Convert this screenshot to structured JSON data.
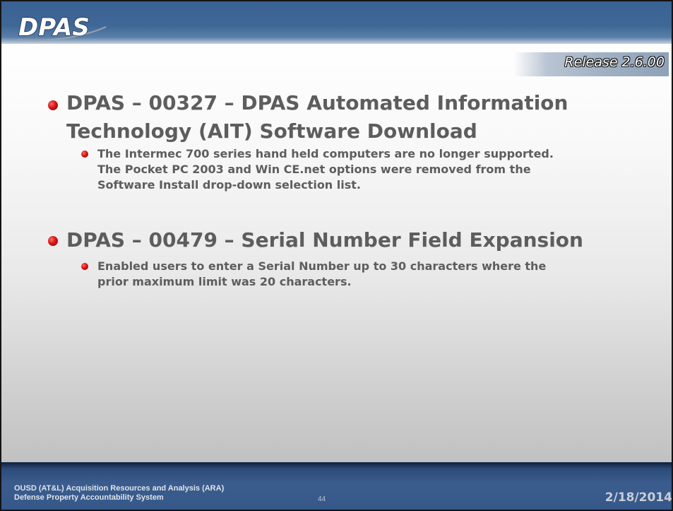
{
  "header": {
    "logo_text": "DPAS",
    "release": "Release 2.6.00"
  },
  "sections": [
    {
      "heading_line1": "DPAS – 00327 – DPAS Automated Information",
      "heading_line2": "Technology (AIT) Software Download",
      "detail_line1": "The Intermec 700 series hand held computers are no longer supported.",
      "detail_line2": "The Pocket PC 2003 and Win CE.net options were removed from the",
      "detail_line3": "Software Install drop-down selection list."
    },
    {
      "heading_line1": "DPAS – 00479 – Serial Number Field Expansion",
      "detail_line1": "Enabled users to enter a Serial Number up to 30 characters where the",
      "detail_line2": "prior maximum limit was 20 characters."
    }
  ],
  "footer": {
    "org_line1": "OUSD (AT&L) Acquisition Resources and Analysis (ARA)",
    "org_line2": "Defense Property Accountability System",
    "page_number": "44",
    "date": "2/18/2014"
  },
  "colors": {
    "header_blue": "#3f6796",
    "bullet_red": "#d61515",
    "body_text": "#5d5d5d",
    "footer_navy": "#2d4b78"
  }
}
